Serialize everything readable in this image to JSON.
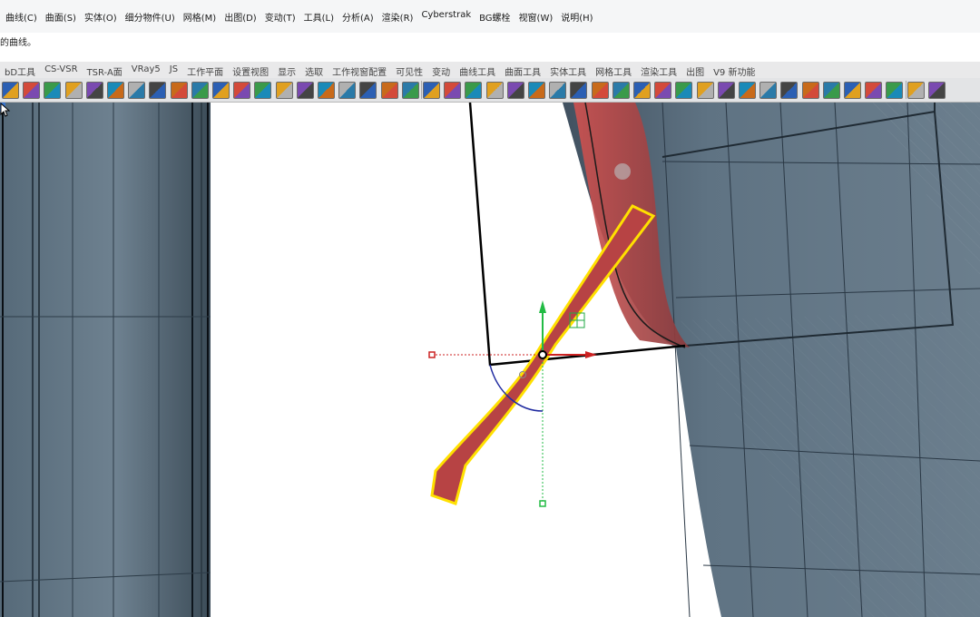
{
  "menu": {
    "items": [
      "曲线(C)",
      "曲面(S)",
      "实体(O)",
      "细分物件(U)",
      "网格(M)",
      "出图(D)",
      "变动(T)",
      "工具(L)",
      "分析(A)",
      "渲染(R)",
      "Cyberstrak",
      "BG螺栓",
      "视窗(W)",
      "说明(H)"
    ]
  },
  "command_line": {
    "text": "的曲线。"
  },
  "tabs": [
    "bD工具",
    "CS-VSR",
    "TSR-A面",
    "VRay5",
    "JS",
    "工作平面",
    "设置视图",
    "显示",
    "选取",
    "工作视窗配置",
    "可见性",
    "变动",
    "曲线工具",
    "曲面工具",
    "实体工具",
    "网格工具",
    "渲染工具",
    "出图",
    "V9 新功能"
  ],
  "toolbar": {
    "icons": [
      "box-icon",
      "extrude-icon",
      "solid-icon",
      "mesh-icon",
      "cut-icon",
      "gradient-icon",
      "surface-icon",
      "fill-icon",
      "checker-icon",
      "camera-icon",
      "target-icon",
      "tag-icon",
      "rotate-icon",
      "move-icon",
      "cylinder-icon",
      "plane-icon",
      "patch-icon",
      "diamond-icon",
      "cube-icon",
      "frame-icon",
      "axis-icon",
      "image-icon",
      "sweep-icon",
      "bounding-icon",
      "blend-icon",
      "pen-icon",
      "layer-icon",
      "curve-icon",
      "dots-icon",
      "pencil-icon",
      "globe-icon",
      "sphere-icon",
      "contrast-icon",
      "paint-icon",
      "ring-icon",
      "star-icon",
      "box2-icon",
      "arc-icon",
      "arc2-icon",
      "drop-icon",
      "cube2-icon",
      "gear1-icon",
      "gear2-icon",
      "gear3-icon",
      "export-icon"
    ]
  },
  "colors": {
    "accent": "#3a74c9",
    "selection": "#ffe000",
    "gizmo_x": "#cc2222",
    "gizmo_y": "#22aa44",
    "model_body": "#5f7282",
    "red_part": "#b8403f"
  }
}
